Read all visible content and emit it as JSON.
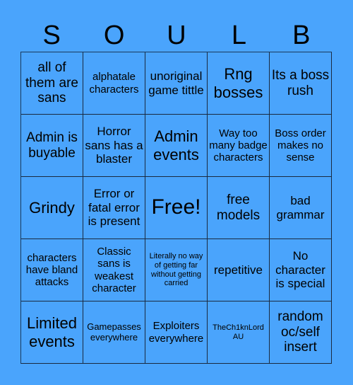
{
  "title_letters": [
    "S",
    "O",
    "U",
    "L",
    "B"
  ],
  "background_color": "#4aa4fc",
  "cells": [
    "all of them are sans",
    "alphatale characters",
    "unoriginal game tittle",
    "Rng bosses",
    "Its a boss rush",
    "Admin is buyable",
    "Horror sans has a blaster",
    "Admin events",
    "Way too many badge characters",
    "Boss order makes no sense",
    "Grindy",
    "Error or fatal error is present",
    "Free!",
    "free models",
    "bad grammar",
    "characters have bland attacks",
    "Classic sans is weakest character",
    "Literally no way of getting far without getting carried",
    "repetitive",
    "No character is special",
    "Limited events",
    "Gamepasses everywhere",
    "Exploiters everywhere",
    "TheCh1knLord AU",
    "random oc/self insert"
  ]
}
